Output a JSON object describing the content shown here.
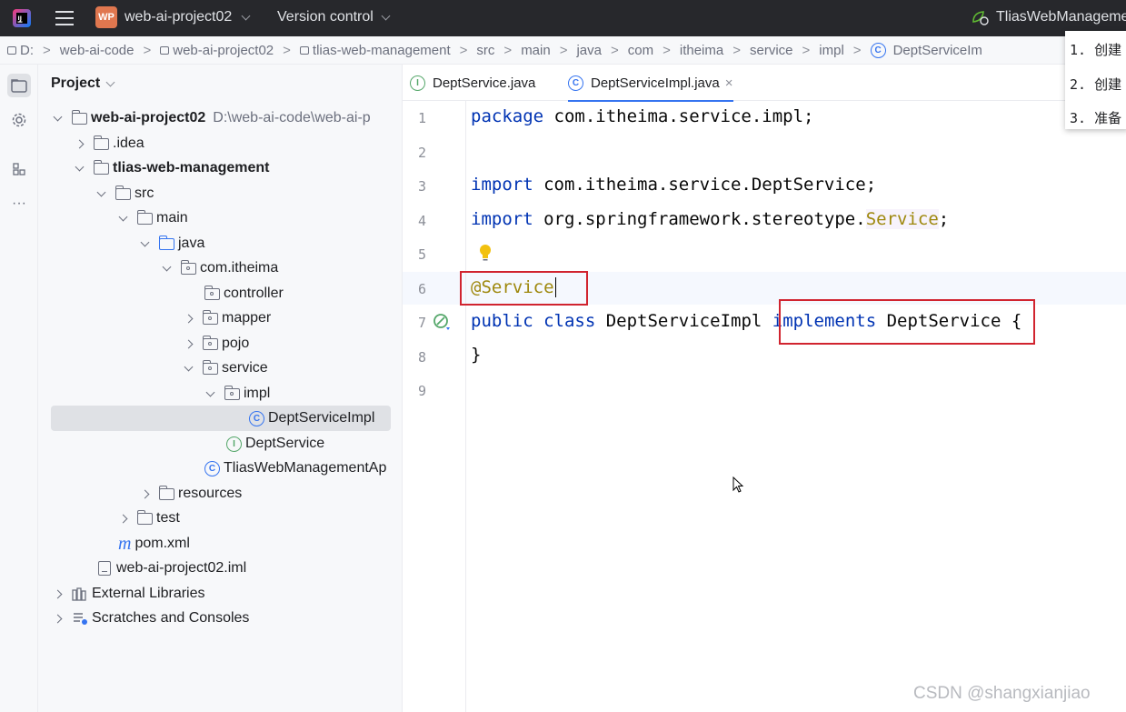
{
  "titlebar": {
    "project_badge": "WP",
    "project_name": "web-ai-project02",
    "version_control": "Version control",
    "run_config": "TliasWebManageme"
  },
  "breadcrumb": [
    "D:",
    "web-ai-code",
    "web-ai-project02",
    "tlias-web-management",
    "src",
    "main",
    "java",
    "com",
    "itheima",
    "service",
    "impl",
    "DeptServiceIm"
  ],
  "project_panel": {
    "title": "Project",
    "tree": [
      {
        "label": "web-ai-project02",
        "hint": "D:\\web-ai-code\\web-ai-p"
      },
      {
        "label": ".idea"
      },
      {
        "label": "tlias-web-management"
      },
      {
        "label": "src"
      },
      {
        "label": "main"
      },
      {
        "label": "java"
      },
      {
        "label": "com.itheima"
      },
      {
        "label": "controller"
      },
      {
        "label": "mapper"
      },
      {
        "label": "pojo"
      },
      {
        "label": "service"
      },
      {
        "label": "impl"
      },
      {
        "label": "DeptServiceImpl"
      },
      {
        "label": "DeptService"
      },
      {
        "label": "TliasWebManagementAp"
      },
      {
        "label": "resources"
      },
      {
        "label": "test"
      },
      {
        "label": "pom.xml"
      },
      {
        "label": "web-ai-project02.iml"
      },
      {
        "label": "External Libraries"
      },
      {
        "label": "Scratches and Consoles"
      }
    ]
  },
  "editor": {
    "tabs": [
      {
        "label": "DeptService.java",
        "icon": "I"
      },
      {
        "label": "DeptServiceImpl.java",
        "icon": "C"
      }
    ],
    "line_numbers": [
      "1",
      "2",
      "3",
      "4",
      "5",
      "6",
      "7",
      "8",
      "9"
    ],
    "code": {
      "l1_kw": "package",
      "l1_rest": " com.itheima.service.impl;",
      "l3_kw": "import",
      "l3_rest": " com.itheima.service.DeptService;",
      "l4_kw": "import",
      "l4_rest": " org.springframework.stereotype.",
      "l4_service": "Service",
      "l4_end": ";",
      "l6_anno": "@Service",
      "l7_kw1": "public",
      "l7_kw2": "class",
      "l7_name": " DeptServiceImpl ",
      "l7_kw3": "implements",
      "l7_iface": " DeptService ",
      "l7_brace": "{",
      "l8": "}"
    }
  },
  "popup": [
    "1. 创建",
    "2. 创建",
    "3. 准备"
  ],
  "watermark": "CSDN @shangxianjiao",
  "colors": {
    "accent": "#3574f0",
    "highlight_box": "#d1242f",
    "titlebar": "#27282c"
  }
}
